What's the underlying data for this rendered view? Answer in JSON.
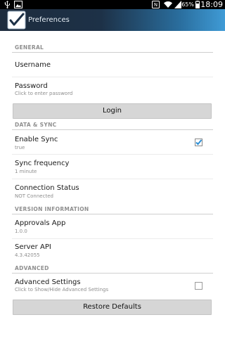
{
  "status_bar": {
    "time": "18:09",
    "battery_percent": "65%",
    "left_icons": [
      "usb-icon",
      "gallery-icon"
    ],
    "right_icons": [
      "nfc-icon",
      "wifi-icon",
      "signal-icon",
      "battery-icon"
    ]
  },
  "action_bar": {
    "title": "Preferences",
    "icon": "checkmark-app-icon"
  },
  "sections": {
    "general": {
      "header": "GENERAL",
      "username_title": "Username",
      "password_title": "Password",
      "password_summary": "Click to enter password",
      "login_label": "Login"
    },
    "data_sync": {
      "header": "DATA & SYNC",
      "enable_sync_title": "Enable Sync",
      "enable_sync_summary": "true",
      "enable_sync_checked": true,
      "sync_frequency_title": "Sync frequency",
      "sync_frequency_summary": "1 minute",
      "connection_status_title": "Connection Status",
      "connection_status_summary": "NOT Connected"
    },
    "version": {
      "header": "VERSION INFORMATION",
      "approvals_app_title": "Approvals App",
      "approvals_app_summary": "1.0.0",
      "server_api_title": "Server API",
      "server_api_summary": "4.3.42055"
    },
    "advanced": {
      "header": "ADVANCED",
      "advanced_settings_title": "Advanced Settings",
      "advanced_settings_summary": "Click to Show/Hide Advanced Settings",
      "advanced_settings_checked": false,
      "restore_defaults_label": "Restore Defaults"
    }
  },
  "colors": {
    "action_bar_dark": "#1d2c3e",
    "action_bar_light": "#3f9bd6",
    "checkbox_accent": "#2d8fd5"
  }
}
